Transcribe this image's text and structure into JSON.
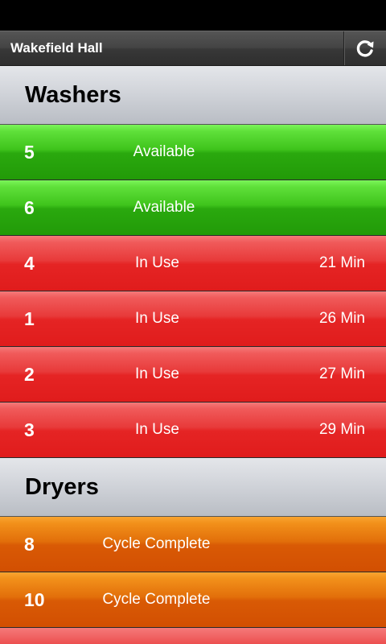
{
  "header": {
    "title": "Wakefield Hall",
    "refresh_icon": "refresh-icon"
  },
  "sections": {
    "washers": {
      "title": "Washers",
      "rows": [
        {
          "number": "5",
          "status": "Available",
          "time": ""
        },
        {
          "number": "6",
          "status": "Available",
          "time": ""
        },
        {
          "number": "4",
          "status": "In Use",
          "time": "21 Min"
        },
        {
          "number": "1",
          "status": "In Use",
          "time": "26 Min"
        },
        {
          "number": "2",
          "status": "In Use",
          "time": "27 Min"
        },
        {
          "number": "3",
          "status": "In Use",
          "time": "29 Min"
        }
      ]
    },
    "dryers": {
      "title": "Dryers",
      "rows": [
        {
          "number": "8",
          "status": "Cycle Complete",
          "time": ""
        },
        {
          "number": "10",
          "status": "Cycle Complete",
          "time": ""
        }
      ]
    }
  },
  "colors": {
    "available": "#2aa90e",
    "in_use": "#e52424",
    "cycle_complete": "#d95a05"
  }
}
